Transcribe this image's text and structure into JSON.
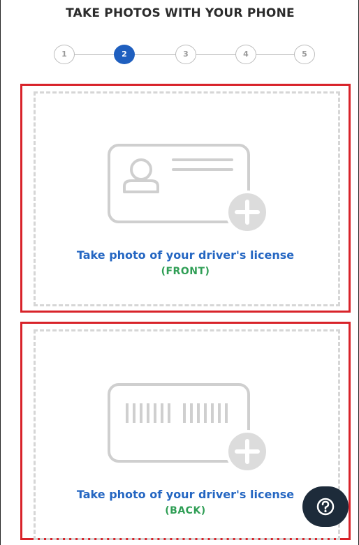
{
  "header": {
    "title": "TAKE PHOTOS WITH YOUR PHONE"
  },
  "stepper": {
    "steps": [
      "1",
      "2",
      "3",
      "4",
      "5"
    ],
    "active_step": "2"
  },
  "cards": {
    "front": {
      "label": "Take photo of your driver's license",
      "side": "(FRONT)",
      "icon": "id-card-add-icon"
    },
    "back": {
      "label": "Take photo of your driver's license",
      "side": "(BACK)",
      "icon": "barcode-card-add-icon"
    }
  },
  "help_button": {
    "icon": "question-mark-icon"
  },
  "colors": {
    "accent_blue": "#2466c2",
    "step_active": "#1f5fbf",
    "side_green": "#2f9e55",
    "highlight_red": "#d8232a",
    "help_bg": "#1d2b3a"
  }
}
